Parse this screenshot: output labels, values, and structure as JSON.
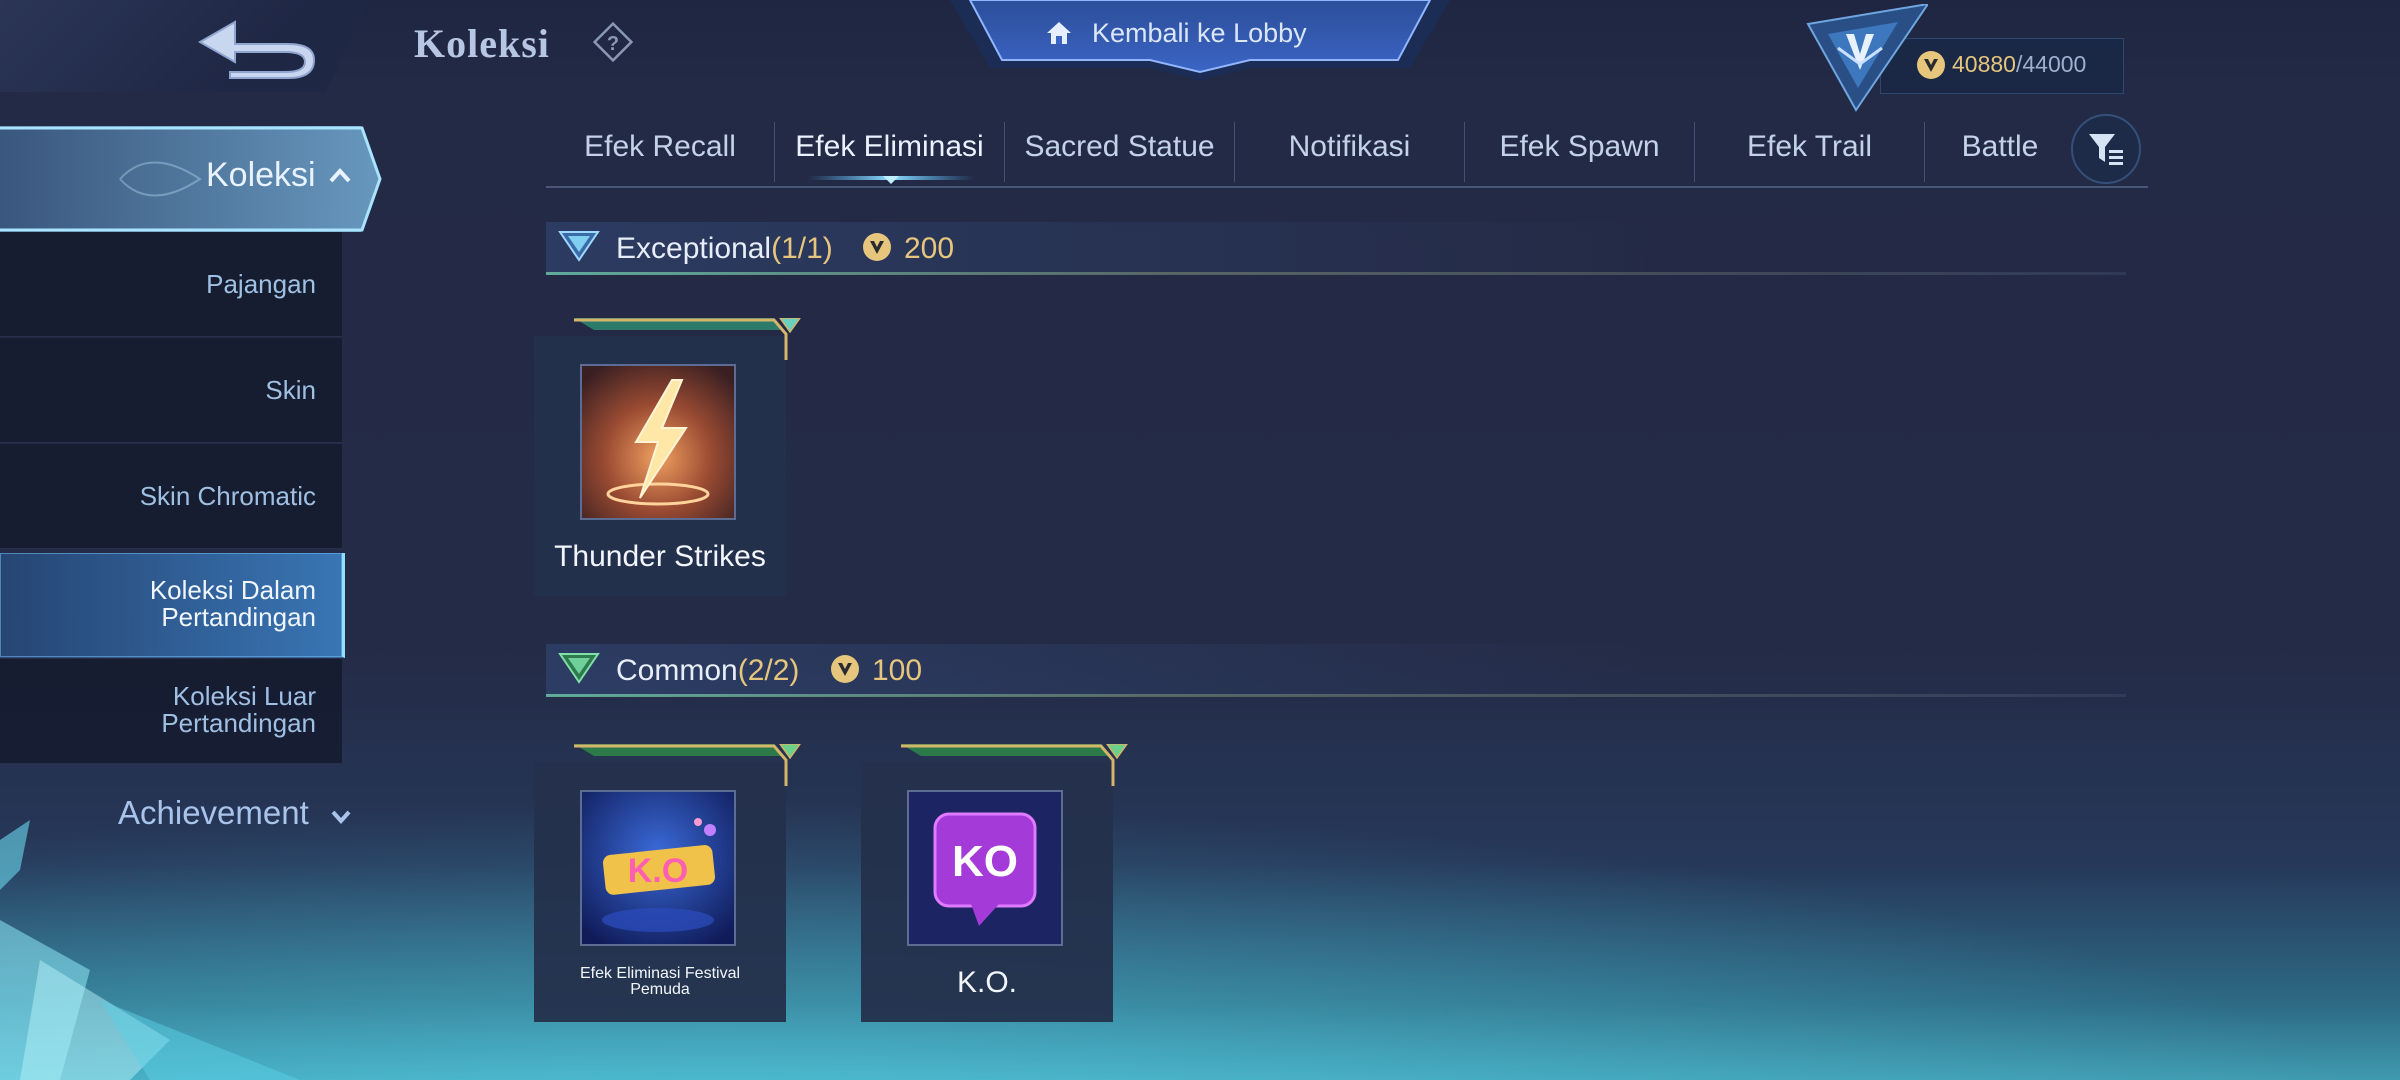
{
  "header": {
    "title": "Koleksi",
    "lobby_label": "Kembali ke Lobby",
    "currency": {
      "current": "40880",
      "separator": "/",
      "max": "44000"
    }
  },
  "sidebar": {
    "main": "Koleksi",
    "items": [
      {
        "label": "Pajangan"
      },
      {
        "label": "Skin"
      },
      {
        "label": "Skin Chromatic"
      },
      {
        "label": "Koleksi Dalam Pertandingan",
        "active": true
      },
      {
        "label": "Koleksi Luar Pertandingan"
      }
    ],
    "achievement": "Achievement"
  },
  "tabs": [
    {
      "label": "Efek Recall"
    },
    {
      "label": "Efek Eliminasi",
      "active": true
    },
    {
      "label": "Sacred Statue"
    },
    {
      "label": "Notifikasi"
    },
    {
      "label": "Efek Spawn"
    },
    {
      "label": "Efek Trail"
    },
    {
      "label": "Battle"
    }
  ],
  "sections": [
    {
      "title": "Exceptional",
      "count": "(1/1)",
      "price": "200",
      "items": [
        {
          "name": "Thunder Strikes"
        }
      ]
    },
    {
      "title": "Common",
      "count": "(2/2)",
      "price": "100",
      "items": [
        {
          "name": "Efek Eliminasi Festival Pemuda"
        },
        {
          "name": "K.O."
        }
      ]
    }
  ],
  "colors": {
    "gold": "#e6c67d",
    "accent": "#8fe0ff",
    "background": "#232a45"
  },
  "icons": [
    "back-arrow-icon",
    "help-icon",
    "home-icon",
    "rank-emblem-icon",
    "coin-icon",
    "chevron-up-icon",
    "chevron-down-icon",
    "filter-icon",
    "rarity-icon"
  ]
}
